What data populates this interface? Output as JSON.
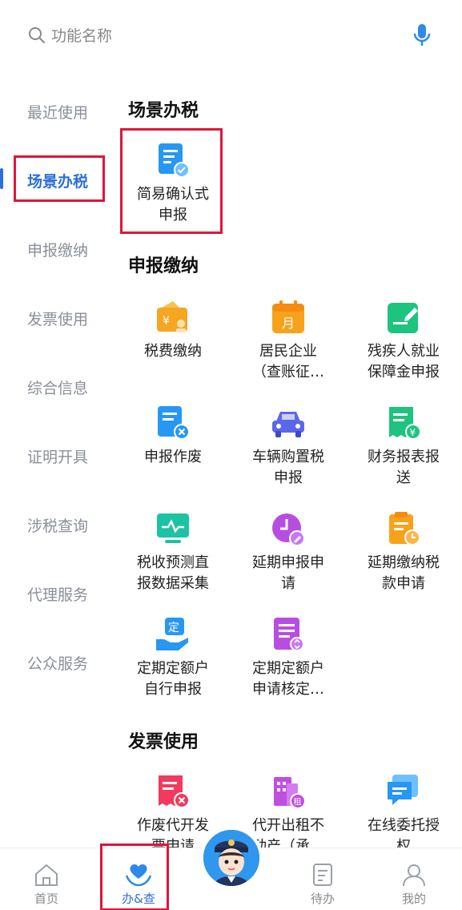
{
  "search": {
    "placeholder": "功能名称"
  },
  "sidebar": {
    "items": [
      "最近使用",
      "场景办税",
      "申报缴纳",
      "发票使用",
      "综合信息",
      "证明开具",
      "涉税查询",
      "代理服务",
      "公众服务"
    ],
    "active": "场景办税"
  },
  "sections": {
    "scene": {
      "title": "场景办税",
      "items": [
        {
          "label": "简易确认式\n申报",
          "icon": "doc-check-icon"
        }
      ]
    },
    "declare": {
      "title": "申报缴纳",
      "items": [
        {
          "label": "税费缴纳",
          "icon": "wallet-yen-icon"
        },
        {
          "label": "居民企业\n（查账征…",
          "icon": "calendar-month-icon"
        },
        {
          "label": "残疾人就业\n保障金申报",
          "icon": "edit-pen-icon"
        },
        {
          "label": "申报作废",
          "icon": "doc-cancel-icon"
        },
        {
          "label": "车辆购置税\n申报",
          "icon": "car-icon"
        },
        {
          "label": "财务报表报\n送",
          "icon": "receipt-yen-icon"
        },
        {
          "label": "税收预测直\n报数据采集",
          "icon": "monitor-chart-icon"
        },
        {
          "label": "延期申报申\n请",
          "icon": "clock-pen-icon"
        },
        {
          "label": "延期缴纳税\n款申请",
          "icon": "clipboard-clock-icon"
        },
        {
          "label": "定期定额户\n自行申报",
          "icon": "hand-fixed-icon"
        },
        {
          "label": "定期定额户\n申请核定…",
          "icon": "list-doc-icon"
        }
      ]
    },
    "invoice": {
      "title": "发票使用",
      "items": [
        {
          "label": "作废代开发\n票申请",
          "icon": "invoice-cancel-icon"
        },
        {
          "label": "代开出租不\n动产（承…",
          "icon": "building-rent-icon"
        },
        {
          "label": "在线委托授\n权",
          "icon": "chat-doc-icon"
        }
      ]
    }
  },
  "bottom_nav": {
    "home": "首页",
    "handle": "办&查",
    "todo": "待办",
    "mine": "我的"
  },
  "colors": {
    "accent": "#2d6fd9",
    "highlight": "#e0153a"
  }
}
